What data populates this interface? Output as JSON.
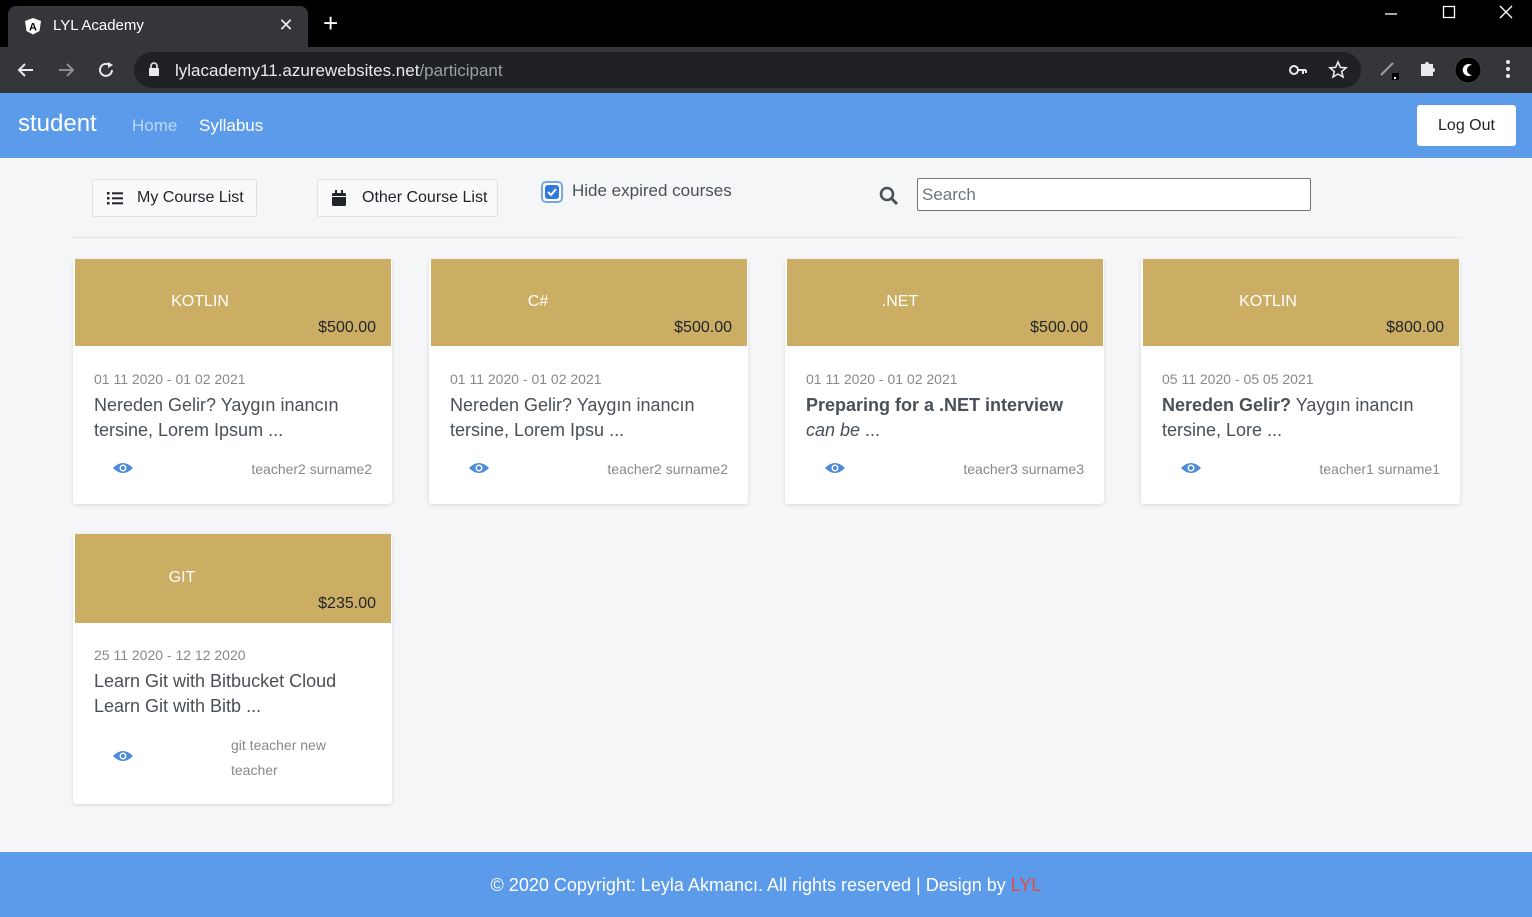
{
  "browser": {
    "tab_title": "LYL Academy",
    "url_host": "lylacademy11.azurewebsites.net",
    "url_path": "/participant"
  },
  "header": {
    "brand": "student",
    "nav": {
      "home": "Home",
      "syllabus": "Syllabus"
    },
    "logout_label": "Log Out"
  },
  "filters": {
    "my_course_list": "My Course List",
    "other_course_list": "Other Course List",
    "hide_expired_label": "Hide expired courses",
    "hide_expired_checked": true,
    "search_placeholder": "Search"
  },
  "courses": [
    {
      "name": "KOTLIN",
      "price": "$500.00",
      "dates": "01 11 2020 - 01 02 2021",
      "desc_bold": "",
      "desc": "Nereden Gelir? Yaygın inancın tersine, Lorem Ipsum ...",
      "desc_italic": "",
      "teacher": "teacher2 surname2"
    },
    {
      "name": "C#",
      "price": "$500.00",
      "dates": "01 11 2020 - 01 02 2021",
      "desc_bold": "",
      "desc": "Nereden Gelir? Yaygın inancın tersine, Lorem Ipsu ...",
      "desc_italic": "",
      "teacher": "teacher2 surname2"
    },
    {
      "name": ".NET",
      "price": "$500.00",
      "dates": "01 11 2020 - 01 02 2021",
      "desc_bold": "Preparing for a .NET interview",
      "desc": "",
      "desc_italic": "can be",
      "desc_tail": " ...",
      "teacher": "teacher3 surname3"
    },
    {
      "name": "KOTLIN",
      "price": "$800.00",
      "dates": "05 11 2020 - 05 05 2021",
      "desc_bold": "Nereden Gelir?",
      "desc": " Yaygın inancın tersine, Lore ...",
      "desc_italic": "",
      "teacher": "teacher1 surname1"
    },
    {
      "name": "GIT",
      "price": "$235.00",
      "dates": "25 11 2020 - 12 12 2020",
      "desc_bold": "",
      "desc": "Learn Git with Bitbucket Cloud Learn Git with Bitb ...",
      "desc_italic": "",
      "teacher": "git teacher new teacher"
    }
  ],
  "footer": {
    "text": "© 2020 Copyright: Leyla Akmancı. All rights reserved | Design by ",
    "design_brand": "LYL"
  },
  "colors": {
    "header_blue": "#5b9bea",
    "card_head_gold": "#cbad63",
    "eye_blue": "#4a8ad9",
    "footer_brand_red": "#e74c3c"
  }
}
